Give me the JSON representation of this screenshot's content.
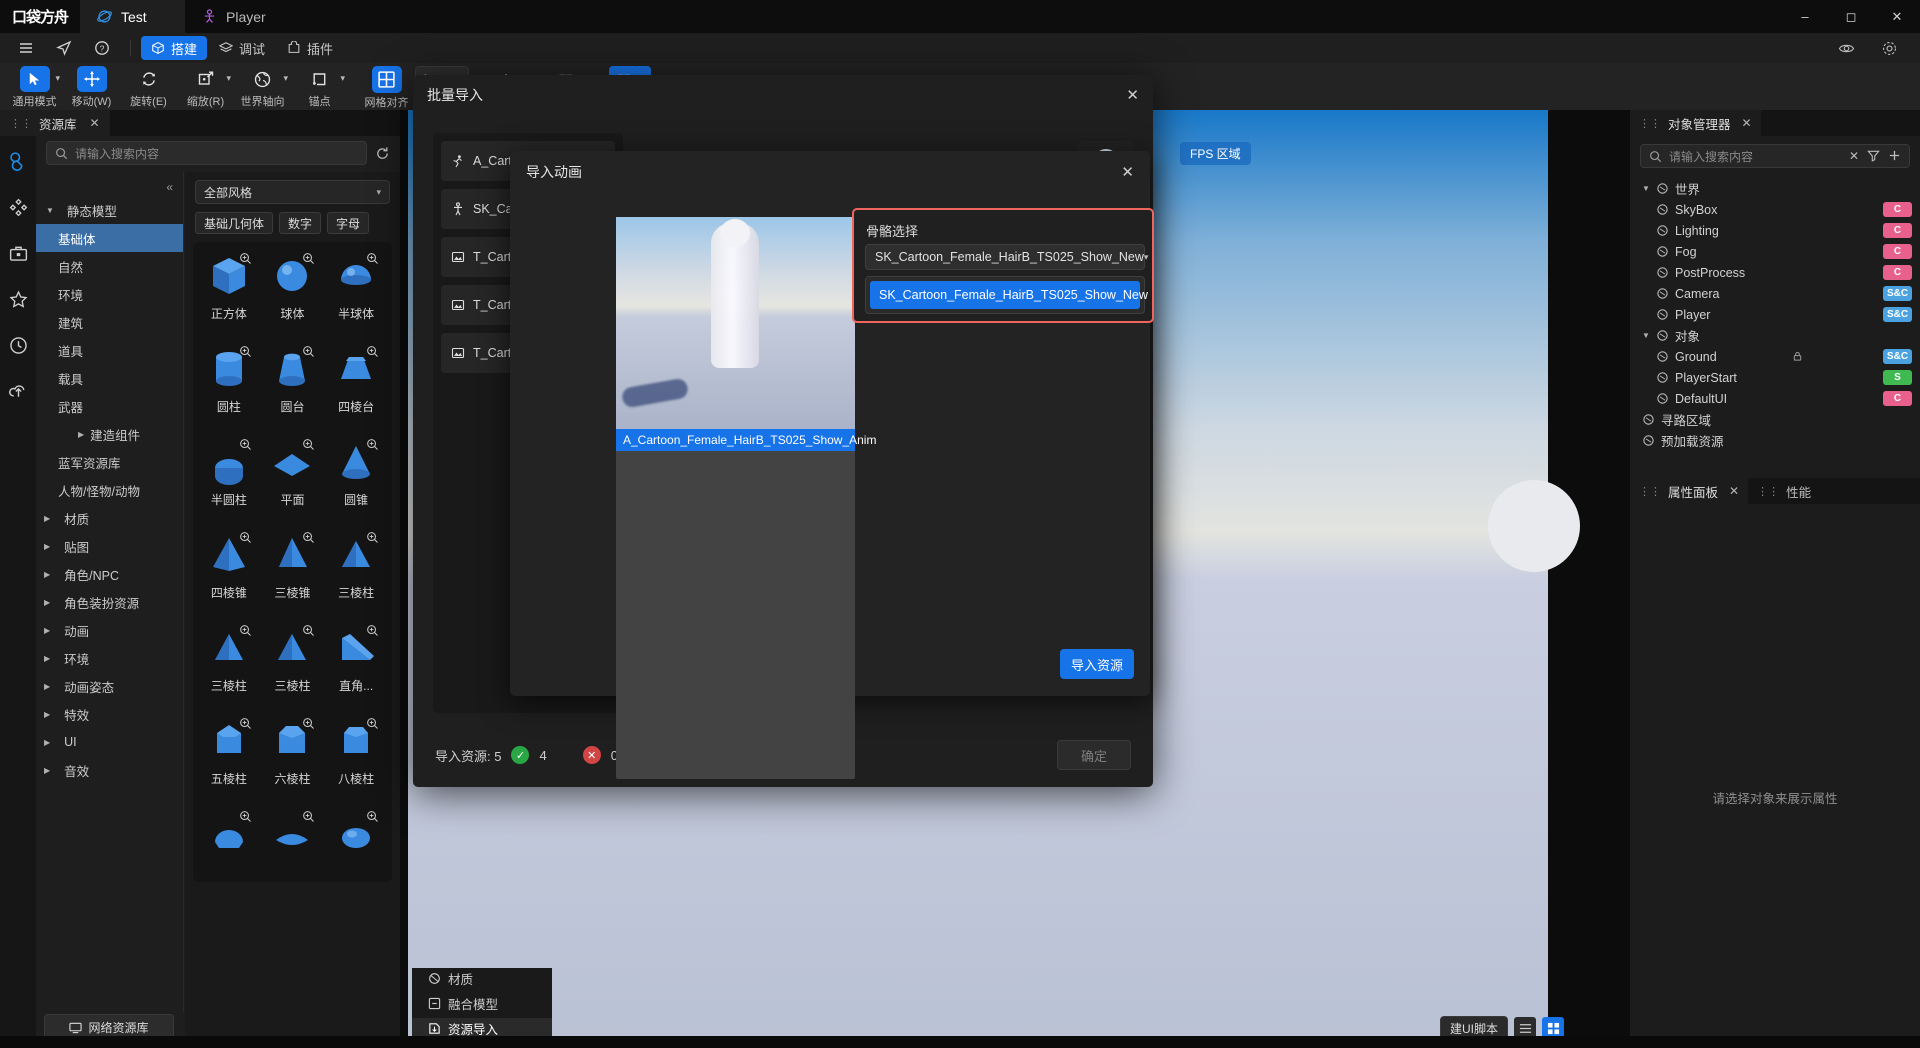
{
  "titlebar": {
    "logo": "口袋方舟",
    "tabs": [
      {
        "label": "Test",
        "icon": "planet-icon",
        "active": true
      },
      {
        "label": "Player",
        "icon": "person-icon",
        "active": false
      }
    ],
    "window_buttons": [
      "minimize",
      "maximize",
      "close"
    ]
  },
  "menubar": {
    "items": [
      {
        "label": "",
        "icon": "hamburger-icon"
      },
      {
        "label": "",
        "icon": "send-icon"
      },
      {
        "label": "",
        "icon": "help-icon"
      }
    ],
    "modes": [
      {
        "label": "搭建",
        "icon": "cube-icon",
        "active": true
      },
      {
        "label": "调试",
        "icon": "layers-icon",
        "active": false
      },
      {
        "label": "插件",
        "icon": "plugin-icon",
        "active": false
      }
    ],
    "right_icons": [
      "eye-icon",
      "settings-icon"
    ]
  },
  "toolbar": {
    "tools": [
      {
        "label": "通用模式",
        "icon": "cursor-icon",
        "selected": true,
        "caret": true
      },
      {
        "label": "移动(W)",
        "icon": "move-icon",
        "selected": true,
        "caret": false
      },
      {
        "label": "旋转(E)",
        "icon": "rotate-icon",
        "selected": false,
        "caret": false
      },
      {
        "label": "缩放(R)",
        "icon": "scale-icon",
        "selected": false,
        "caret": true
      },
      {
        "label": "世界轴向",
        "icon": "globe-icon",
        "selected": false,
        "caret": true
      },
      {
        "label": "锚点",
        "icon": "anchor-icon",
        "selected": false,
        "caret": true
      },
      {
        "label": "网格对齐",
        "icon": "grid-icon",
        "selected": true,
        "caret": false
      }
    ],
    "grid_value": "1",
    "extra_buttons": [
      {
        "icon": "vertex-snap-icon",
        "on": false
      },
      {
        "icon": "bars-icon",
        "on": false
      },
      {
        "icon": "layout-icon",
        "on": true,
        "caret": true
      },
      {
        "icon": "align-left-icon",
        "on": false
      },
      {
        "icon": "align-center-icon",
        "on": false
      },
      {
        "icon": "align-right-icon",
        "on": false
      }
    ]
  },
  "resource_panel": {
    "tab_title": "资源库",
    "search_placeholder": "请输入搜索内容",
    "refresh_icon": "refresh-icon",
    "collapse_icon": "collapse-left-icon",
    "rail_icons": [
      "assets-icon",
      "components-icon",
      "toolbox-icon",
      "star-icon",
      "recent-icon",
      "upload-icon"
    ],
    "tree": [
      {
        "label": "静态模型",
        "type": "header",
        "expanded": true
      },
      {
        "label": "基础体",
        "type": "leaf",
        "selected": true
      },
      {
        "label": "自然",
        "type": "leaf"
      },
      {
        "label": "环境",
        "type": "leaf"
      },
      {
        "label": "建筑",
        "type": "leaf"
      },
      {
        "label": "道具",
        "type": "leaf"
      },
      {
        "label": "载具",
        "type": "leaf"
      },
      {
        "label": "武器",
        "type": "leaf"
      },
      {
        "label": "建造组件",
        "type": "sub",
        "caret": true
      },
      {
        "label": "蓝军资源库",
        "type": "leaf"
      },
      {
        "label": "人物/怪物/动物",
        "type": "leaf"
      },
      {
        "label": "材质",
        "type": "expandable"
      },
      {
        "label": "贴图",
        "type": "expandable"
      },
      {
        "label": "角色/NPC",
        "type": "expandable"
      },
      {
        "label": "角色装扮资源",
        "type": "expandable"
      },
      {
        "label": "动画",
        "type": "expandable"
      },
      {
        "label": "环境",
        "type": "expandable"
      },
      {
        "label": "动画姿态",
        "type": "expandable"
      },
      {
        "label": "特效",
        "type": "expandable"
      },
      {
        "label": "UI",
        "type": "expandable"
      },
      {
        "label": "音效",
        "type": "expandable"
      }
    ],
    "network_library_button": "网络资源库",
    "style_filter": "全部风格",
    "chips": [
      "基础几何体",
      "数字",
      "字母"
    ],
    "assets": [
      {
        "name": "正方体",
        "shape": "cube"
      },
      {
        "name": "球体",
        "shape": "sphere"
      },
      {
        "name": "半球体",
        "shape": "hemisphere"
      },
      {
        "name": "圆柱",
        "shape": "cylinder"
      },
      {
        "name": "圆台",
        "shape": "cone-trunc"
      },
      {
        "name": "四棱台",
        "shape": "square-frustum"
      },
      {
        "name": "半圆柱",
        "shape": "half-cylinder"
      },
      {
        "name": "平面",
        "shape": "plane"
      },
      {
        "name": "圆锥",
        "shape": "cone"
      },
      {
        "name": "四棱锥",
        "shape": "pyramid4"
      },
      {
        "name": "三棱锥",
        "shape": "pyramid3"
      },
      {
        "name": "三棱柱",
        "shape": "prism3"
      },
      {
        "name": "三棱柱",
        "shape": "prism3b"
      },
      {
        "name": "三棱柱",
        "shape": "prism3c"
      },
      {
        "name": "直角...",
        "shape": "wedge"
      },
      {
        "name": "五棱柱",
        "shape": "prism5"
      },
      {
        "name": "六棱柱",
        "shape": "prism6"
      },
      {
        "name": "八棱柱",
        "shape": "prism8"
      },
      {
        "name": "",
        "shape": "blob1"
      },
      {
        "name": "",
        "shape": "blob2"
      },
      {
        "name": "",
        "shape": "blob3"
      }
    ]
  },
  "viewport": {
    "fps_badge": "FPS 区域"
  },
  "object_manager": {
    "tab_title": "对象管理器",
    "search_placeholder": "请输入搜索内容",
    "toolbar_icons": [
      "clear-icon",
      "filter-icon",
      "add-icon"
    ],
    "tree": [
      {
        "label": "世界",
        "depth": 0,
        "caret": "down",
        "icon": "world-icon"
      },
      {
        "label": "SkyBox",
        "depth": 1,
        "icon": "skybox-icon",
        "badge": "C",
        "badge_type": "c"
      },
      {
        "label": "Lighting",
        "depth": 1,
        "icon": "light-icon",
        "badge": "C",
        "badge_type": "c"
      },
      {
        "label": "Fog",
        "depth": 1,
        "icon": "fog-icon",
        "badge": "C",
        "badge_type": "c"
      },
      {
        "label": "PostProcess",
        "depth": 1,
        "icon": "post-icon",
        "badge": "C",
        "badge_type": "c"
      },
      {
        "label": "Camera",
        "depth": 1,
        "icon": "camera-icon",
        "badge": "S&C",
        "badge_type": "sc"
      },
      {
        "label": "Player",
        "depth": 1,
        "icon": "player-icon",
        "badge": "S&C",
        "badge_type": "sc"
      },
      {
        "label": "对象",
        "depth": 0,
        "caret": "down",
        "icon": "objects-icon"
      },
      {
        "label": "Ground",
        "depth": 1,
        "icon": "ground-icon",
        "lock": true,
        "badge": "S&C",
        "badge_type": "sc"
      },
      {
        "label": "PlayerStart",
        "depth": 1,
        "icon": "start-icon",
        "badge": "S",
        "badge_type": "s"
      },
      {
        "label": "DefaultUI",
        "depth": 1,
        "icon": "ui-icon",
        "badge": "C",
        "badge_type": "c"
      },
      {
        "label": "寻路区域",
        "depth": 0,
        "icon": "nav-icon"
      },
      {
        "label": "预加载资源",
        "depth": 0,
        "icon": "preload-icon"
      }
    ],
    "property_tabs": [
      {
        "label": "属性面板",
        "active": true,
        "closable": true
      },
      {
        "label": "性能",
        "active": false,
        "closable": false
      }
    ],
    "property_empty_text": "请选择对象来展示属性"
  },
  "batch_import_modal": {
    "title": "批量导入",
    "close_icon": "close-icon",
    "files": [
      {
        "name": "A_Cart",
        "icon": "anim-icon",
        "status": "loading"
      },
      {
        "name": "SK_Ca",
        "icon": "skeleton-icon",
        "status": "ok"
      },
      {
        "name": "T_Cart",
        "icon": "texture-icon",
        "status": "ok"
      },
      {
        "name": "T_Cart",
        "icon": "texture-icon",
        "status": "ok"
      },
      {
        "name": "T_Cart",
        "icon": "texture-icon",
        "status": "ok"
      }
    ],
    "footer": {
      "label": "导入资源: 5",
      "success_count": "4",
      "error_count": "0",
      "confirm_button": "确定"
    }
  },
  "import_animation_dialog": {
    "title": "导入动画",
    "close_icon": "close-icon",
    "animation_name": "A_Cartoon_Female_HairB_TS025_Show_Anim",
    "skeleton_section": {
      "label": "骨骼选择",
      "selected": "SK_Cartoon_Female_HairB_TS025_Show_New",
      "options": [
        "SK_Cartoon_Female_HairB_TS025_Show_New"
      ]
    },
    "import_button": "导入资源"
  },
  "bottom_tabs": [
    {
      "label": "材质",
      "icon": "material-icon",
      "selected": false
    },
    {
      "label": "融合模型",
      "icon": "merge-icon",
      "selected": false
    },
    {
      "label": "资源导入",
      "icon": "import-icon",
      "selected": true
    }
  ],
  "viewport_bottom": {
    "script_button": "建UI脚本"
  },
  "colors": {
    "accent": "#1773e8",
    "success": "#2aa745",
    "highlight_border": "#f0655d",
    "badge_c": "#e8618c",
    "badge_sc": "#4aa3e0",
    "badge_s": "#3fb950"
  }
}
